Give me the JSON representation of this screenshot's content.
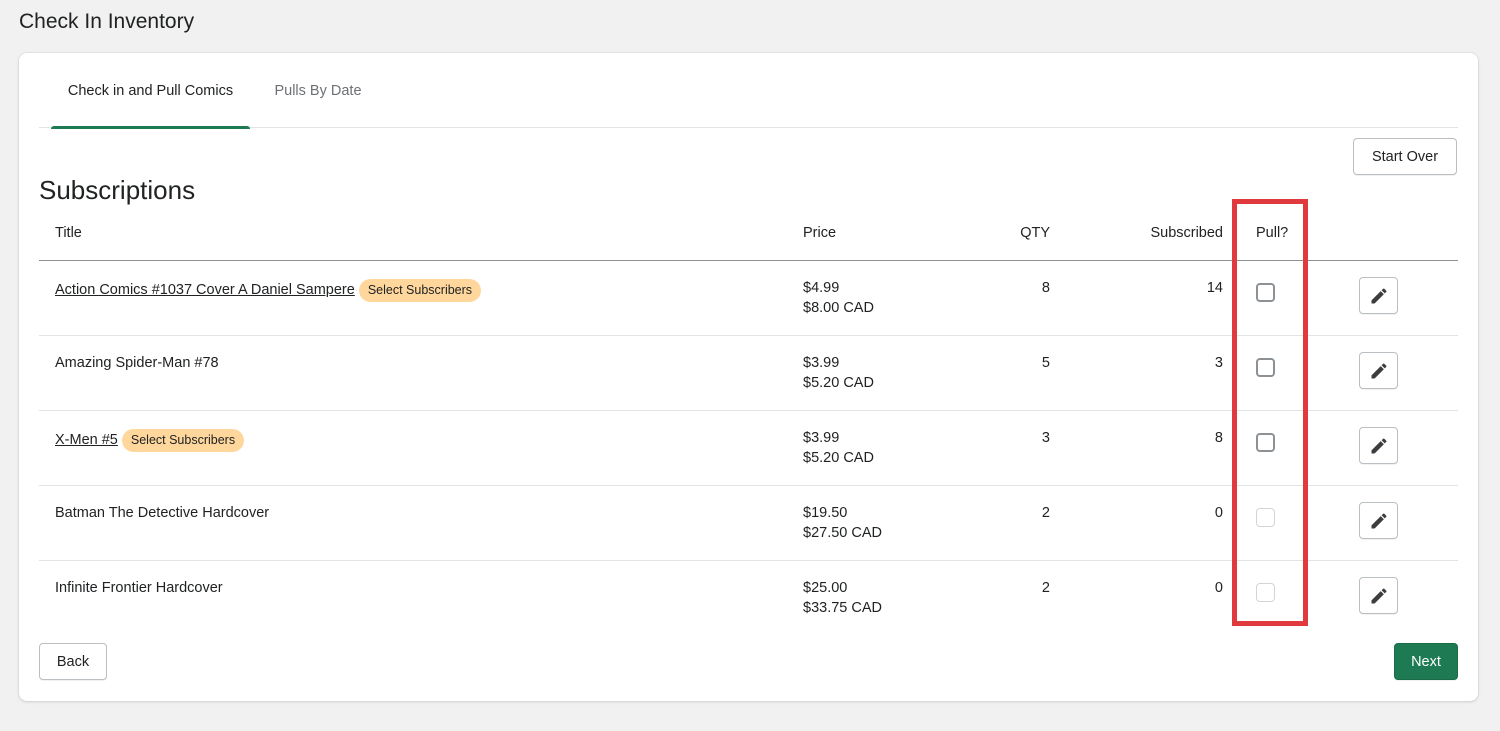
{
  "page": {
    "title": "Check In Inventory"
  },
  "tabs": [
    {
      "label": "Check in and Pull Comics",
      "active": true
    },
    {
      "label": "Pulls By Date",
      "active": false
    }
  ],
  "actions": {
    "start_over": "Start Over",
    "back": "Back",
    "next": "Next"
  },
  "section": {
    "title": "Subscriptions"
  },
  "table": {
    "headers": {
      "title": "Title",
      "price": "Price",
      "qty": "QTY",
      "subscribed": "Subscribed",
      "pull": "Pull?"
    },
    "rows": [
      {
        "title": "Action Comics #1037 Cover A Daniel Sampere",
        "link": true,
        "badge": "Select Subscribers",
        "price_usd": "$4.99",
        "price_cad": "$8.00 CAD",
        "qty": "8",
        "subscribed": "14",
        "pull_checked": false,
        "pull_enabled": true
      },
      {
        "title": "Amazing Spider-Man #78",
        "link": false,
        "badge": "",
        "price_usd": "$3.99",
        "price_cad": "$5.20 CAD",
        "qty": "5",
        "subscribed": "3",
        "pull_checked": false,
        "pull_enabled": true
      },
      {
        "title": "X-Men #5",
        "link": true,
        "badge": "Select Subscribers",
        "price_usd": "$3.99",
        "price_cad": "$5.20 CAD",
        "qty": "3",
        "subscribed": "8",
        "pull_checked": false,
        "pull_enabled": true
      },
      {
        "title": "Batman The Detective Hardcover",
        "link": false,
        "badge": "",
        "price_usd": "$19.50",
        "price_cad": "$27.50 CAD",
        "qty": "2",
        "subscribed": "0",
        "pull_checked": false,
        "pull_enabled": false
      },
      {
        "title": "Infinite Frontier Hardcover",
        "link": false,
        "badge": "",
        "price_usd": "$25.00",
        "price_cad": "$33.75 CAD",
        "qty": "2",
        "subscribed": "0",
        "pull_checked": false,
        "pull_enabled": false
      }
    ]
  },
  "colors": {
    "primary": "#1e7a52",
    "badge": "#ffd79d",
    "highlight": "#e0393e",
    "background": "#f1f1f1"
  },
  "icons": {
    "edit": "pencil-icon"
  }
}
